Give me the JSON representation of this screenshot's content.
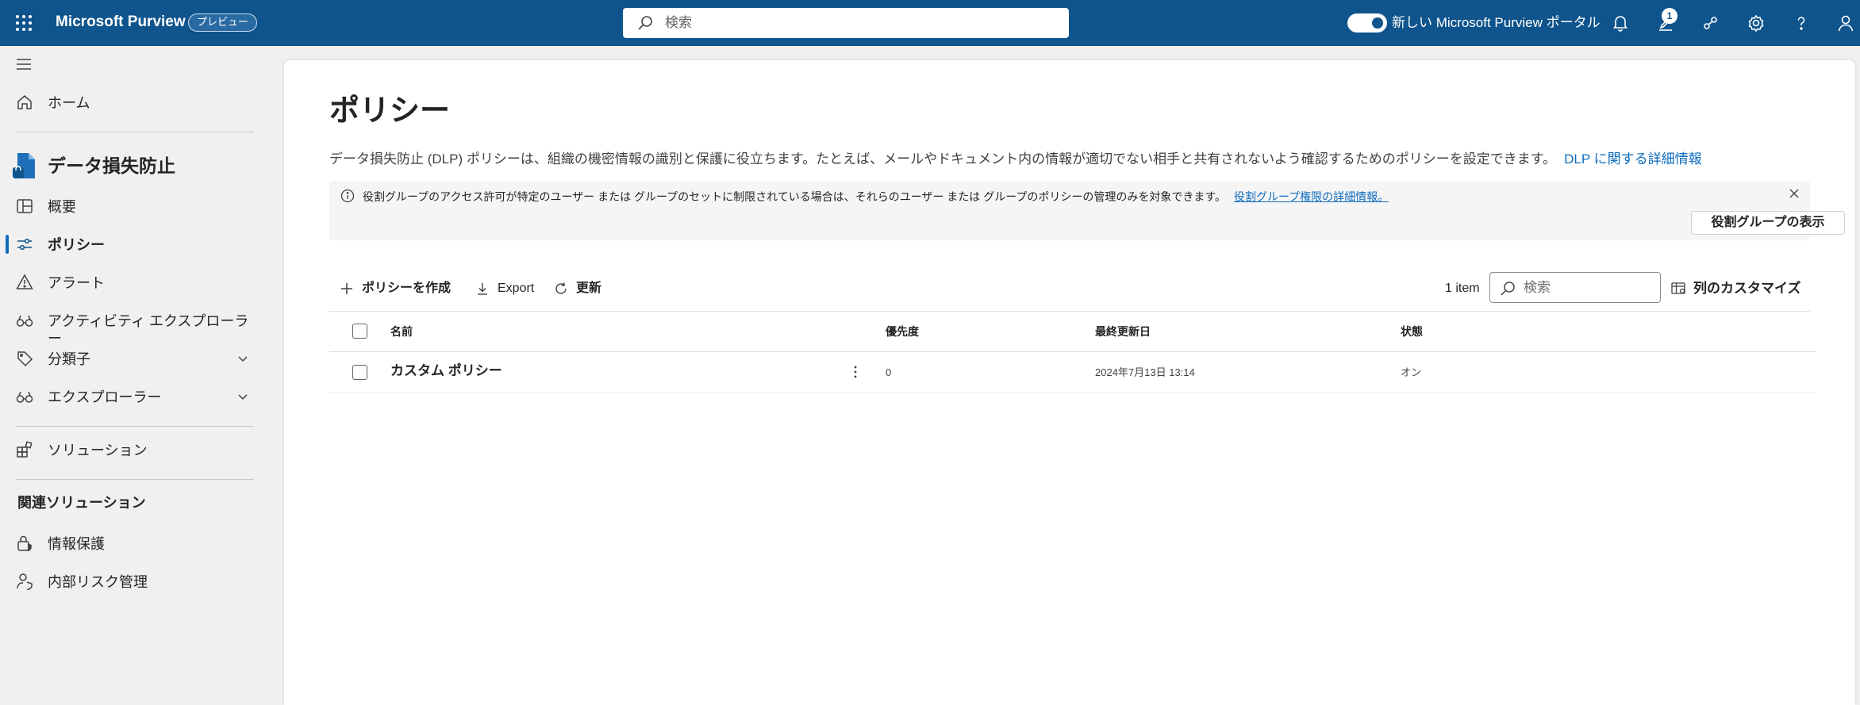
{
  "topbar": {
    "app_name": "Microsoft Purview",
    "preview_badge": "プレビュー",
    "search_placeholder": "検索",
    "toggle_label": "新しい Microsoft Purview ポータル",
    "toggle_on": true,
    "notification_count": "1",
    "icons": [
      "app-launcher-icon",
      "search-icon",
      "bell-icon",
      "feedback-icon",
      "share-icon",
      "settings-icon",
      "help-icon",
      "account-icon"
    ]
  },
  "sidebar": {
    "home_label": "ホーム",
    "section_title": "データ損失防止",
    "items": [
      {
        "label": "概要",
        "icon": "overview-icon"
      },
      {
        "label": "ポリシー",
        "icon": "policy-sliders-icon",
        "active": true
      },
      {
        "label": "アラート",
        "icon": "alert-icon"
      },
      {
        "label": "アクティビティ エクスプローラー",
        "icon": "binoculars-icon"
      },
      {
        "label": "分類子",
        "icon": "tag-icon",
        "expandable": true
      },
      {
        "label": "エクスプローラー",
        "icon": "binoculars-icon",
        "expandable": true
      }
    ],
    "solutions_label": "ソリューション",
    "related_title": "関連ソリューション",
    "related": [
      {
        "label": "情報保護",
        "icon": "info-protection-icon"
      },
      {
        "label": "内部リスク管理",
        "icon": "insider-risk-icon"
      }
    ]
  },
  "main": {
    "title": "ポリシー",
    "description": "データ損失防止 (DLP) ポリシーは、組織の機密情報の識別と保護に役立ちます。たとえば、メールやドキュメント内の情報が適切でない相手と共有されないよう確認するためのポリシーを設定できます。",
    "learn_more_link": "DLP に関する詳細情報",
    "banner": {
      "message": "役割グループのアクセス許可が特定のユーザー または グループのセットに制限されている場合は、それらのユーザー または グループのポリシーの管理のみを対象できます。",
      "link": "役割グループ権限の詳細情報。",
      "button": "役割グループの表示"
    },
    "commands": {
      "create": "ポリシーを作成",
      "export": "Export",
      "refresh": "更新"
    },
    "item_count": "1 item",
    "grid_search_placeholder": "検索",
    "customize_columns": "列のカスタマイズ",
    "table": {
      "columns": [
        "名前",
        "優先度",
        "最終更新日",
        "状態"
      ],
      "rows": [
        {
          "name": "カスタム ポリシー",
          "priority": "0",
          "last_modified": "2024年7月13日 13:14",
          "status": "オン"
        }
      ]
    }
  },
  "colors": {
    "topbar": "#0f548c",
    "accent": "#0f6cbd",
    "sidebar_bg": "#f0f0f0",
    "card_bg": "#ffffff"
  }
}
